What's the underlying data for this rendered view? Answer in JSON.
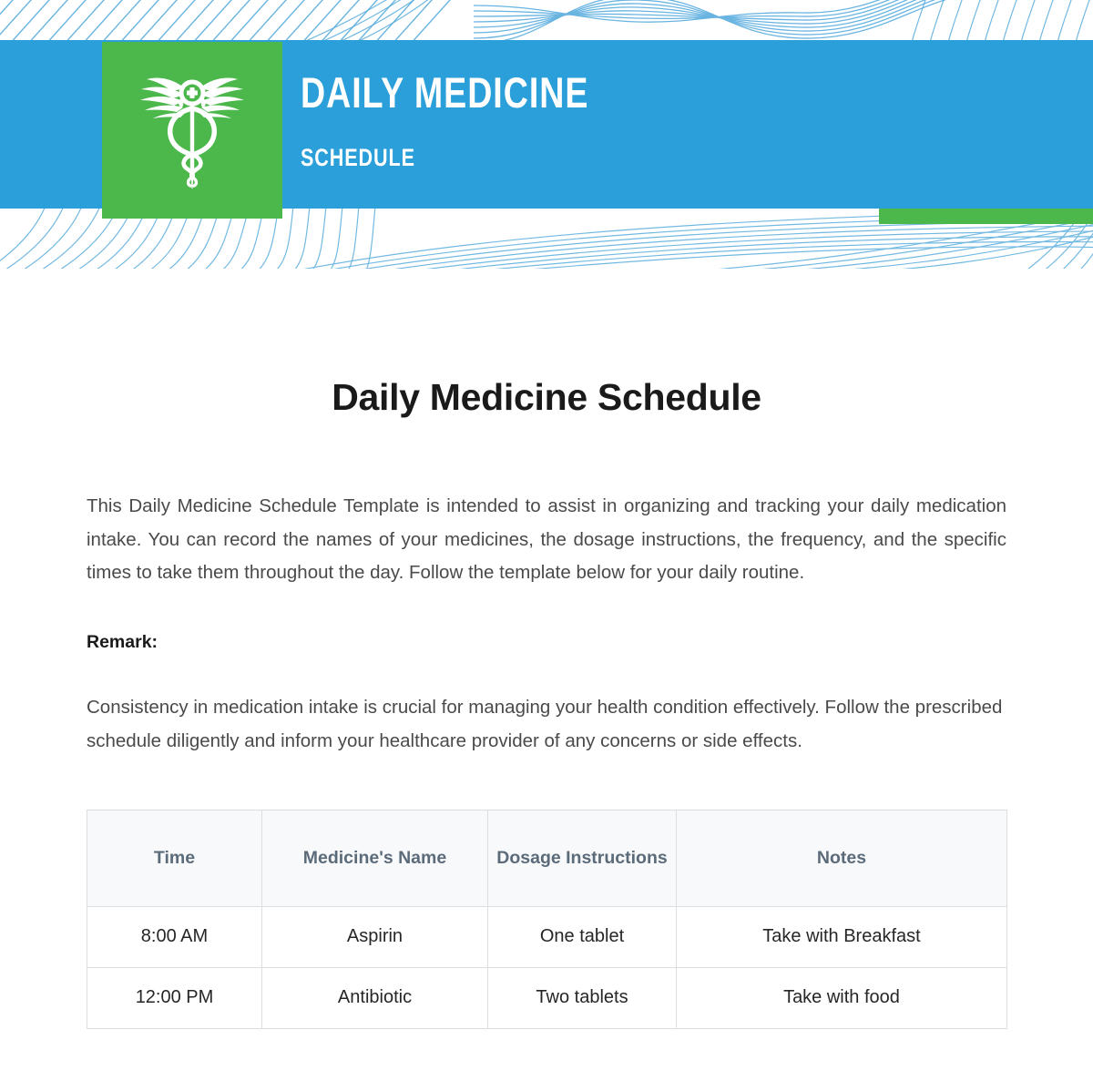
{
  "banner": {
    "title": "DAILY MEDICINE",
    "subtitle": "SCHEDULE",
    "logo_icon": "caduceus-icon",
    "blue": "#2b9fd9",
    "green": "#4cb84c"
  },
  "document": {
    "title": "Daily Medicine Schedule",
    "intro": "This Daily Medicine Schedule Template is intended to assist in organizing and tracking your daily medication intake. You can record the names of your medicines, the dosage instructions, the frequency, and the specific times to take them throughout the day. Follow the template below for your daily routine.",
    "remark_label": "Remark:",
    "remark_text": "Consistency in medication intake is crucial for managing your health condition effectively. Follow the prescribed schedule diligently and inform your healthcare provider of any concerns or side effects."
  },
  "table": {
    "headers": [
      "Time",
      "Medicine's Name",
      "Dosage Instructions",
      "Notes"
    ],
    "rows": [
      {
        "time": "8:00 AM",
        "name": "Aspirin",
        "dosage": "One tablet",
        "notes": "Take with Breakfast"
      },
      {
        "time": "12:00 PM",
        "name": "Antibiotic",
        "dosage": "Two tablets",
        "notes": "Take with food"
      }
    ]
  }
}
